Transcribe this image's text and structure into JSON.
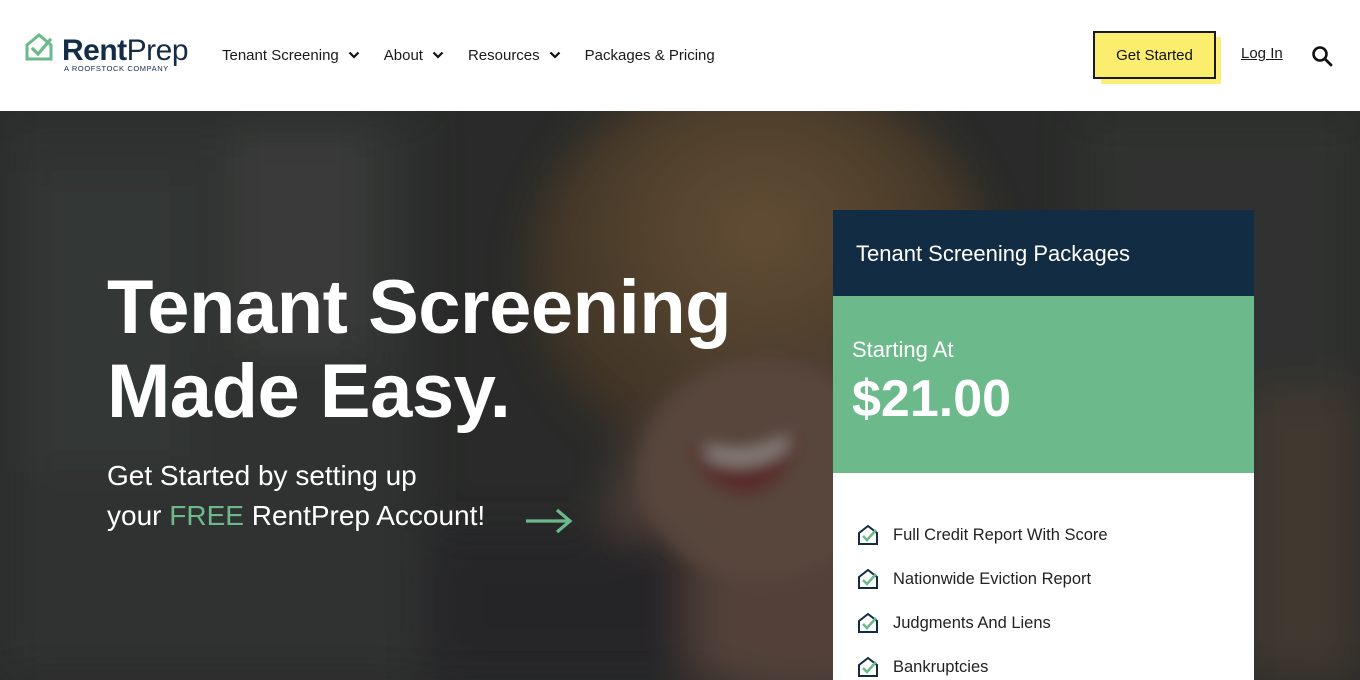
{
  "brand": {
    "name_bold": "Rent",
    "name_light": "Prep",
    "tagline": "A ROOFSTOCK COMPANY",
    "logo_icon": "house-check-icon",
    "accent_color": "#6cba8b",
    "navy_color": "#122c44",
    "cta_color": "#fbee6f"
  },
  "nav": {
    "items": [
      {
        "label": "Tenant Screening",
        "dropdown": true
      },
      {
        "label": "About",
        "dropdown": true
      },
      {
        "label": "Resources",
        "dropdown": true
      },
      {
        "label": "Packages & Pricing",
        "dropdown": false
      }
    ],
    "cta_label": "Get Started",
    "login_label": "Log In",
    "search_icon": "search-icon"
  },
  "hero": {
    "title_line1": "Tenant Screening",
    "title_line2": "Made Easy.",
    "sub_line1": "Get Started by setting up",
    "sub_line2_pre": "your ",
    "sub_line2_free": "FREE",
    "sub_line2_post": " RentPrep Account!",
    "arrow_icon": "arrow-right-icon"
  },
  "card": {
    "title": "Tenant Screening Packages",
    "starting_label": "Starting At",
    "price": "$21.00",
    "features": [
      "Full Credit Report With Score",
      "Nationwide Eviction Report",
      "Judgments And Liens",
      "Bankruptcies"
    ]
  }
}
